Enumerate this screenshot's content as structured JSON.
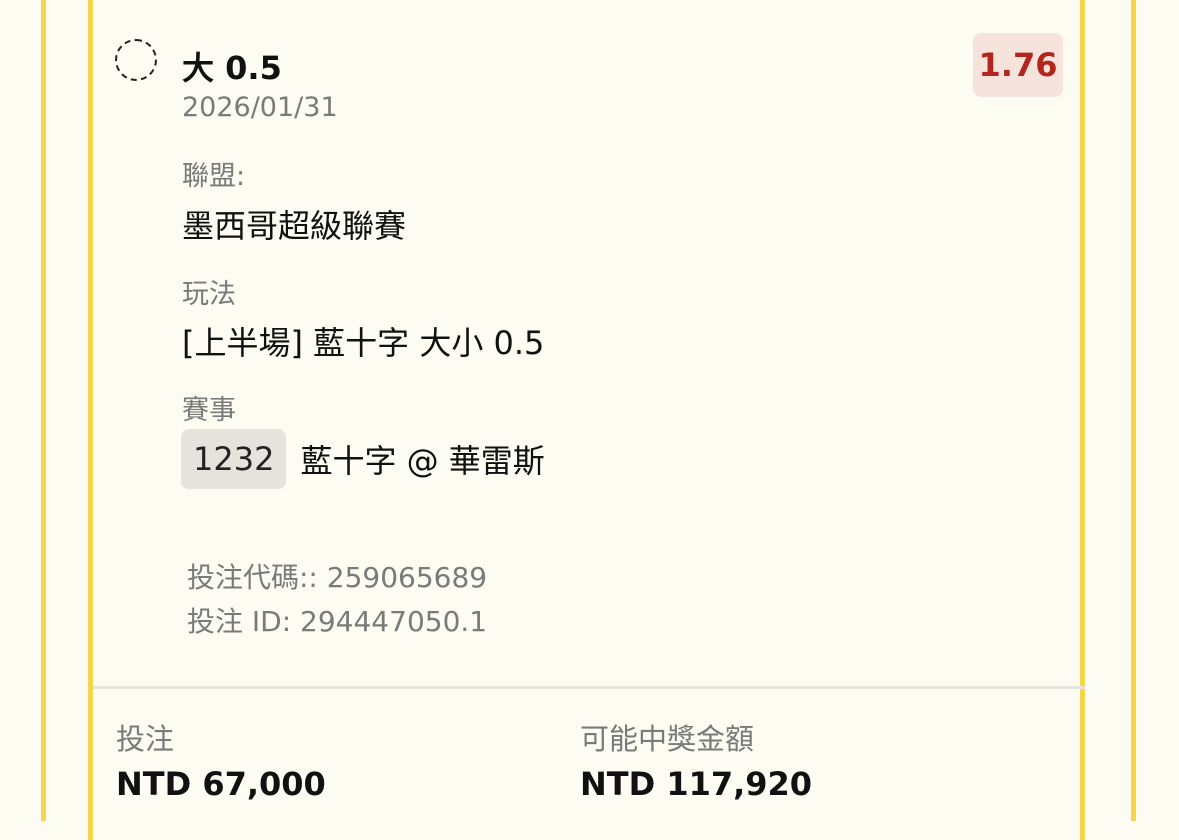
{
  "bet": {
    "selection": "大 0.5",
    "date": "2026/01/31",
    "odds": "1.76",
    "league_label": "聯盟:",
    "league_value": "墨西哥超級聯賽",
    "market_label": "玩法",
    "market_value": "[上半場] 藍十字 大小 0.5",
    "event_label": "賽事",
    "event_code": "1232",
    "event_name": "藍十字 @ 華雷斯",
    "bet_code": "投注代碼:: 259065689",
    "bet_id": "投注 ID: 294447050.1"
  },
  "footer": {
    "stake_label": "投注",
    "stake_value": "NTD 67,000",
    "payout_label": "可能中獎金額",
    "payout_value": "NTD 117,920"
  },
  "colors": {
    "accent_border": "#f6d54a",
    "odds_text": "#b3261e",
    "odds_bg": "#f6e4dc",
    "background": "#fdfcf2"
  }
}
